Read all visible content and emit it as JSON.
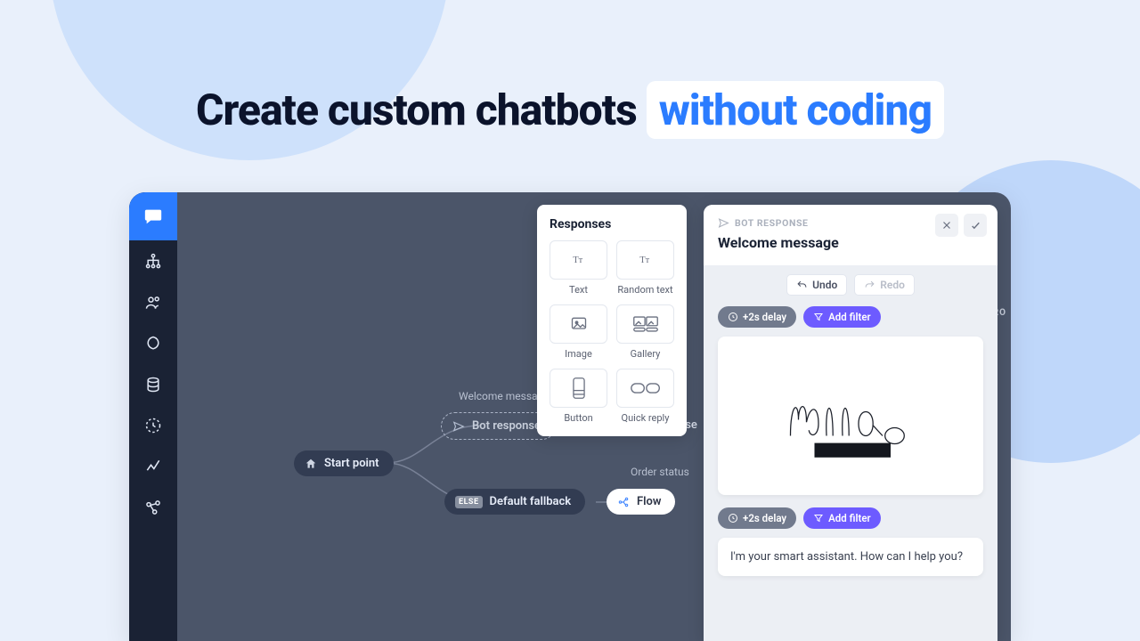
{
  "headline": {
    "prefix": "Create custom chatbots",
    "highlight": "without coding"
  },
  "responses": {
    "title": "Responses",
    "items": [
      {
        "id": "text",
        "label": "Text"
      },
      {
        "id": "random-text",
        "label": "Random text"
      },
      {
        "id": "image",
        "label": "Image"
      },
      {
        "id": "gallery",
        "label": "Gallery"
      },
      {
        "id": "button",
        "label": "Button"
      },
      {
        "id": "quick-reply",
        "label": "Quick reply"
      }
    ]
  },
  "canvas": {
    "start": "Start point",
    "welcome_hint": "Welcome message",
    "bot_response": "Bot response",
    "bot_response2": "Bot response",
    "fallback": "Default fallback",
    "else_badge": "ELSE",
    "flow": "Flow",
    "order_status": "Order status"
  },
  "detail": {
    "kicker": "BOT RESPONSE",
    "title": "Welcome message",
    "undo": "Undo",
    "redo": "Redo",
    "delay_chip": "+2s delay",
    "filter_chip": "Add filter",
    "message": "I'm your smart assistant. How can I help you?"
  },
  "bg_labels": {
    "pro": "PRO"
  }
}
